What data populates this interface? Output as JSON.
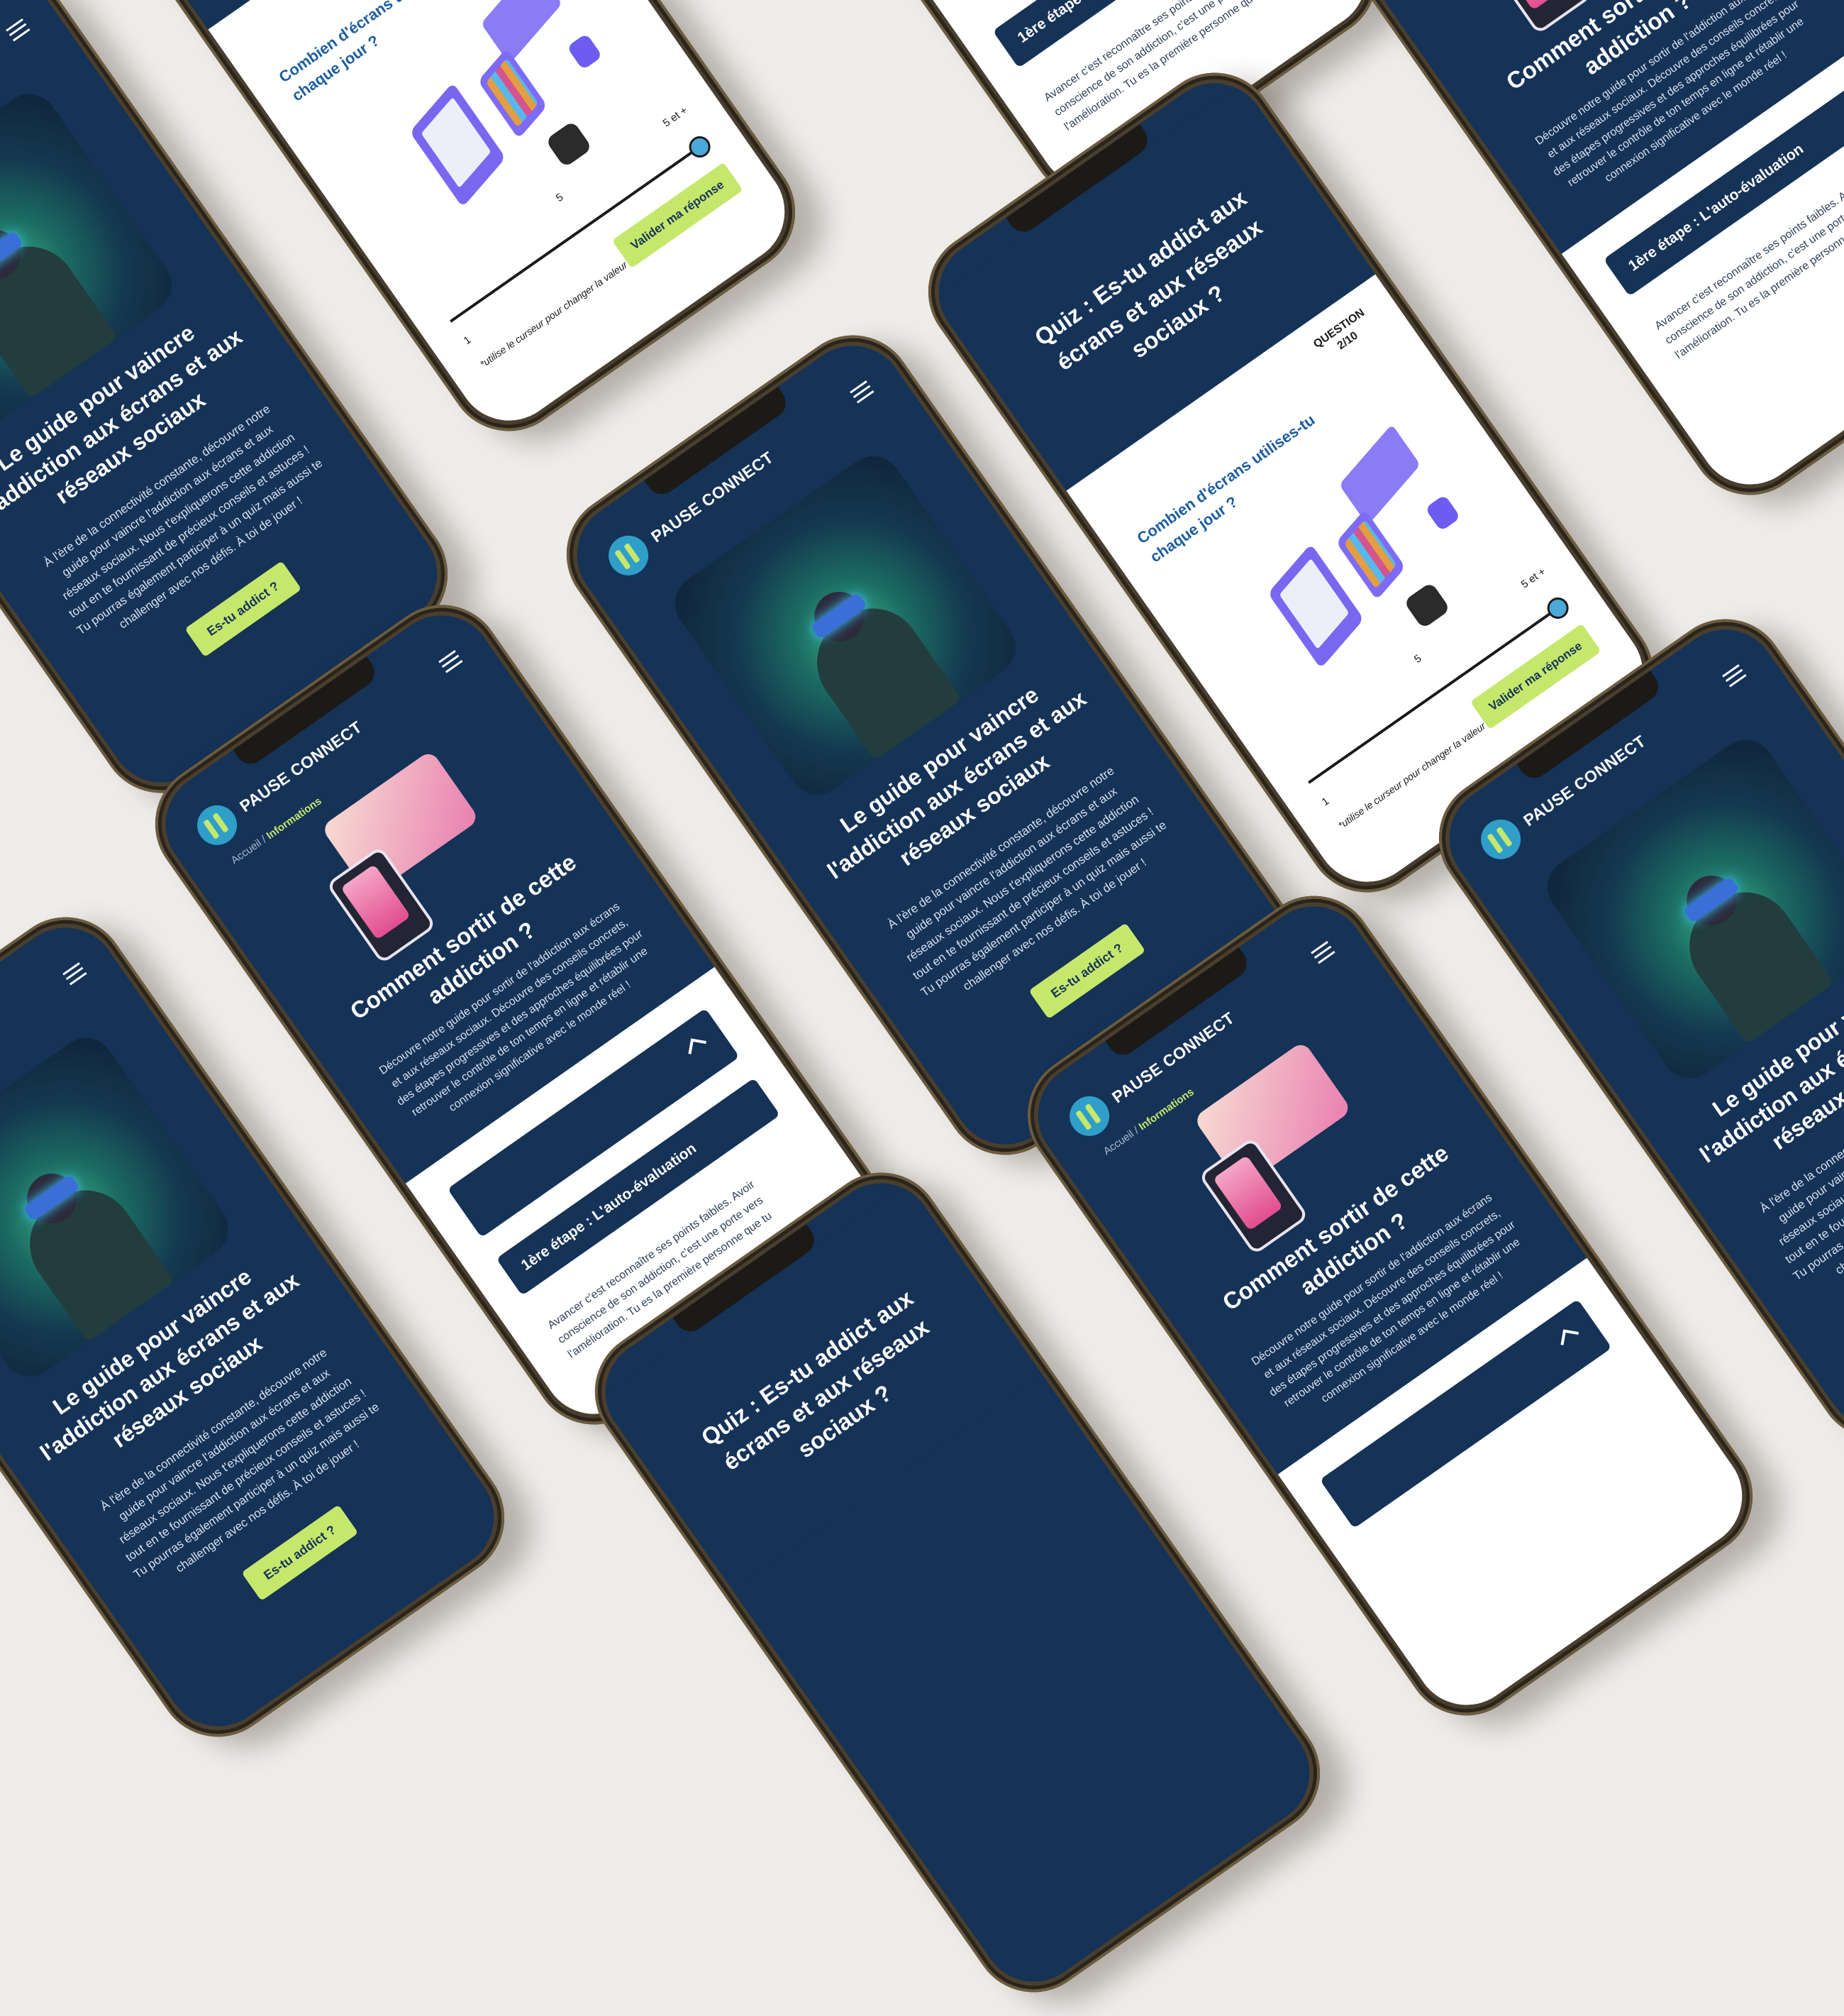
{
  "brand": "PAUSE CONNECT",
  "hero": {
    "title": "Le guide pour vaincre l'addiction aux écrans et aux réseaux sociaux",
    "text": "À l'ère de la connectivité constante, découvre notre guide pour vaincre l'addiction aux écrans et aux réseaux sociaux. Nous t'expliquerons cette addiction tout en te fournissant de précieux conseils et astuces ! Tu pourras également participer à un quiz mais aussi te challenger avec nos défis. À toi de jouer !",
    "cta_label": "Es-tu addict ?"
  },
  "info": {
    "breadcrumb_home": "Accueil",
    "breadcrumb_sep": "/",
    "breadcrumb_current": "Informations",
    "title": "Comment sortir de cette addiction ?",
    "text": "Découvre notre guide pour sortir de l'addiction aux écrans et aux réseaux sociaux. Découvre des conseils concrets, des étapes progressives et des approches équilibrées pour retrouver le contrôle de ton temps en ligne et rétablir une connexion significative avec le monde réel !",
    "step_title": "1ère étape : L'auto-évaluation",
    "step_text": "Avancer c'est reconnaître ses points faibles. Avoir conscience de son addiction, c'est une porte vers l'amélioration. Tu es la première personne que tu"
  },
  "quiz": {
    "title": "Quiz : Es-tu addict aux écrans et aux réseaux sociaux ?",
    "question_label": "QUESTION",
    "question_index": "2/10",
    "question": "Combien d'écrans utilises-tu chaque jour ?",
    "scale_min": "1",
    "scale_mid": "5",
    "scale_max": "5 et +",
    "hint": "*utilise le curseur pour changer la valeur",
    "validate_label": "Valider ma réponse"
  },
  "colors": {
    "navy": "#153257",
    "accent": "#c5e86c",
    "logo_blue": "#2f9ec8"
  }
}
